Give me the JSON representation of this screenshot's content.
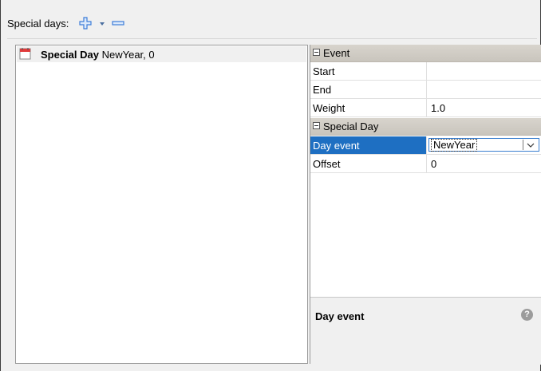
{
  "toolbar": {
    "label": "Special days:",
    "add_icon": "plus-icon",
    "dropdown_icon": "triangle-down-icon",
    "remove_icon": "minus-icon"
  },
  "list": {
    "items": [
      {
        "bold": "Special Day",
        "rest": " NewYear, 0",
        "icon": "calendar-icon"
      }
    ]
  },
  "properties": {
    "categories": [
      {
        "label": "Event"
      },
      {
        "label": "Special Day"
      }
    ],
    "rows": [
      {
        "name": "Start",
        "value": ""
      },
      {
        "name": "End",
        "value": ""
      },
      {
        "name": "Weight",
        "value": "1.0"
      },
      {
        "name": "Day event",
        "value": "NewYear",
        "selected": true
      },
      {
        "name": "Offset",
        "value": "0"
      }
    ]
  },
  "description": {
    "title": "Day event",
    "help_icon": "help-icon",
    "help_glyph": "?"
  },
  "colors": {
    "selection": "#1e6fc2",
    "category_band": "#d1cdc6",
    "add_icon": "#3d7dd8"
  }
}
